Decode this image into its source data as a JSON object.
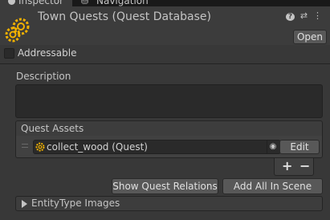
{
  "tabs": [
    {
      "label": "Inspector",
      "icon": "info-icon"
    },
    {
      "label": "Navigation",
      "icon": "navigation-icon"
    }
  ],
  "header": {
    "title": "Town Quests (Quest Database)",
    "open_label": "Open",
    "icons": [
      "help-icon",
      "preset-icon",
      "more-icon"
    ]
  },
  "addressable": {
    "label": "Addressable",
    "checked": false
  },
  "description": {
    "label": "Description",
    "value": ""
  },
  "quest_assets": {
    "label": "Quest Assets",
    "items": [
      {
        "value": "collect_wood (Quest)",
        "edit_label": "Edit"
      }
    ],
    "add_label": "+",
    "remove_label": "−"
  },
  "buttons": {
    "show_relations": "Show Quest Relations",
    "add_all": "Add All In Scene"
  },
  "foldout": {
    "label": "EntityType Images",
    "expanded": false
  },
  "colors": {
    "accent": "#f0b000",
    "background": "#383838"
  }
}
